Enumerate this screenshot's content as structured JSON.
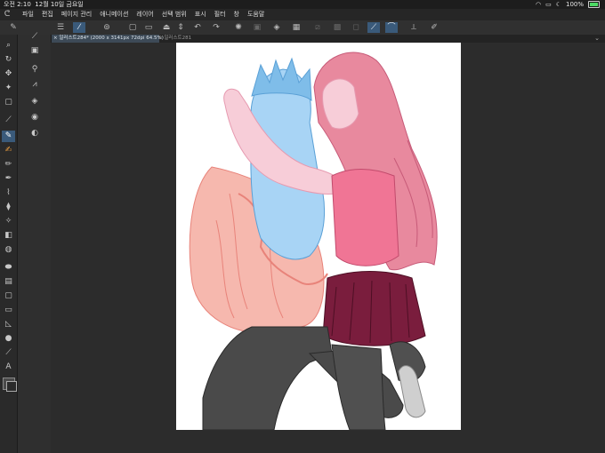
{
  "status": {
    "time": "오전 2:10",
    "date": "12월 10일 금요일",
    "battery": "100%",
    "icons": [
      "wifi-icon",
      "screen-mirror-icon",
      "moon-icon",
      "battery-icon"
    ]
  },
  "menu": {
    "items": [
      "파일",
      "편집",
      "페이지 관리",
      "애니메이션",
      "레이어",
      "선택 범위",
      "표시",
      "필터",
      "창",
      "도움말"
    ]
  },
  "tabs": [
    {
      "label": "일러스트284* (2000 x 3141px 72dpi 64.5%)"
    },
    {
      "label": "일러스트281"
    }
  ],
  "colors": {
    "accent": "#3a5a7a",
    "skin_blue": "#a8d4f5",
    "skin_pink": "#f7cdd8",
    "hair_pink": "#e8899e",
    "shirt_salmon": "#f6b8ae",
    "pants_dark": "#4a4a4a",
    "skirt_wine": "#7a1d3d",
    "top_pink": "#f07595"
  },
  "toolbox": {
    "tools": [
      "zoom-icon",
      "rotate-icon",
      "move-icon",
      "wand-icon",
      "select-rect-icon",
      "eyedropper-icon",
      "pen-icon",
      "brush-icon",
      "pencil-icon",
      "marker-icon",
      "airbrush-icon",
      "fill-bucket-icon",
      "decoration-icon",
      "eraser-icon",
      "blend-icon",
      "figure-icon",
      "gradient-icon",
      "frame-icon",
      "ruler-icon",
      "shape-icon",
      "sphere-icon",
      "line-icon",
      "text-icon"
    ]
  }
}
